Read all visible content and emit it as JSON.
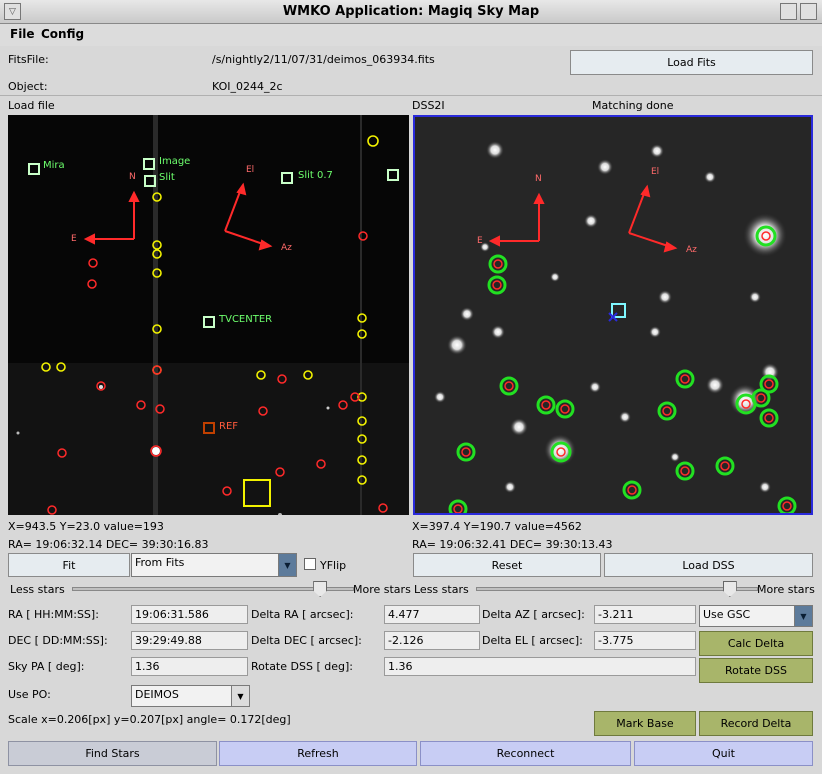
{
  "window": {
    "title": "WMKO Application: Magiq Sky Map"
  },
  "menu": {
    "file": "File",
    "config": "Config"
  },
  "header": {
    "fitsfile_label": "FitsFile:",
    "fitsfile_value": "/s/nightly2/11/07/31/deimos_063934.fits",
    "object_label": "Object:",
    "object_value": "KOI_0244_2c",
    "load_fits": "Load Fits"
  },
  "left_panel": {
    "title": "Load file",
    "labels": {
      "mira": "Mira",
      "image": "Image",
      "slit": "Slit",
      "slit07": "Slit 0.7",
      "tvcenter": "TVCENTER",
      "ref": "REF",
      "n": "N",
      "e": "E",
      "el": "El",
      "az": "Az"
    },
    "cursor_xy": "X=943.5 Y=23.0 value=193",
    "cursor_radec": "RA= 19:06:32.14 DEC= 39:30:16.83",
    "fit_button": "Fit",
    "source_select": "From Fits",
    "yflip": "YFlip",
    "less_stars": "Less stars",
    "more_stars": "More stars"
  },
  "right_panel": {
    "title": "DSS2I",
    "status": "Matching done",
    "labels": {
      "n": "N",
      "e": "E",
      "el": "El",
      "az": "Az"
    },
    "cursor_xy": "X=397.4 Y=190.7 value=4562",
    "cursor_radec": "RA= 19:06:32.41 DEC= 39:30:13.43",
    "reset_button": "Reset",
    "load_dss_button": "Load DSS",
    "less_stars": "Less stars",
    "more_stars": "More stars"
  },
  "params": {
    "ra_label": "RA [ HH:MM:SS]:",
    "ra_value": "19:06:31.586",
    "dec_label": "DEC [ DD:MM:SS]:",
    "dec_value": "39:29:49.88",
    "skypa_label": "Sky PA [ deg]:",
    "skypa_value": "1.36",
    "dra_label": "Delta RA [ arcsec]:",
    "dra_value": "4.477",
    "ddec_label": "Delta DEC [ arcsec]:",
    "ddec_value": "-2.126",
    "rotdss_label": "Rotate DSS [ deg]:",
    "rotdss_value": "1.36",
    "daz_label": "Delta AZ [ arcsec]:",
    "daz_value": "-3.211",
    "del_label": "Delta EL [ arcsec]:",
    "del_value": "-3.775",
    "catalog_select": "Use GSC",
    "calc_delta": "Calc Delta",
    "rotate_dss": "Rotate DSS",
    "use_po_label": "Use PO:",
    "use_po_value": "DEIMOS",
    "scale_text": "Scale x=0.206[px] y=0.207[px] angle= 0.172[deg]",
    "mark_base": "Mark Base",
    "record_delta": "Record Delta"
  },
  "bottom": {
    "find_stars": "Find Stars",
    "refresh": "Refresh",
    "reconnect": "Reconnect",
    "quit": "Quit"
  },
  "slider_levels": {
    "left": 0.88,
    "right": 0.9
  },
  "colors": {
    "accent_blue": "#2a2adb",
    "green_button": "#a8b56a",
    "marker_red": "#ff2a2a",
    "marker_yellow": "#f2f200",
    "marker_green": "#6dff6d"
  }
}
